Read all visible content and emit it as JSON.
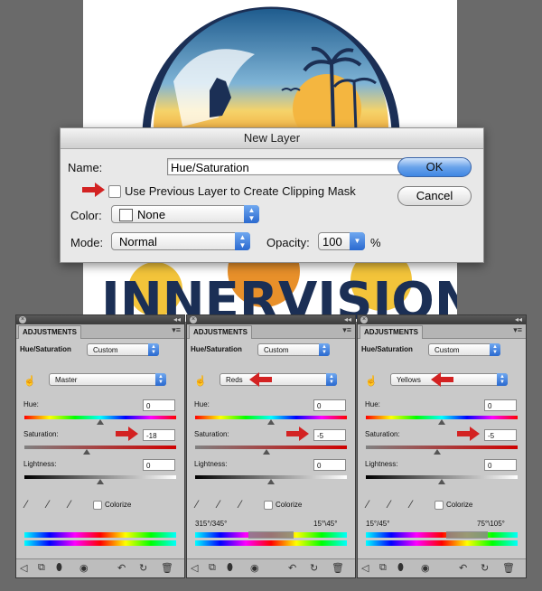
{
  "dialog": {
    "title": "New Layer",
    "name_label": "Name:",
    "name_value": "Hue/Saturation",
    "clip_label": "Use Previous Layer to Create Clipping Mask",
    "color_label": "Color:",
    "color_value": "None",
    "mode_label": "Mode:",
    "mode_value": "Normal",
    "opacity_label": "Opacity:",
    "opacity_value": "100",
    "opacity_unit": "%",
    "ok_label": "OK",
    "cancel_label": "Cancel"
  },
  "artwork": {
    "logo_text": "INNERVISIONS"
  },
  "panels": [
    {
      "tab": "ADJUSTMENTS",
      "type": "Hue/Saturation",
      "preset": "Custom",
      "channel": "Master",
      "hue_label": "Hue:",
      "hue": "0",
      "sat_label": "Saturation:",
      "sat": "-18",
      "light_label": "Lightness:",
      "light": "0",
      "colorize_label": "Colorize",
      "range_left": "",
      "range_right": ""
    },
    {
      "tab": "ADJUSTMENTS",
      "type": "Hue/Saturation",
      "preset": "Custom",
      "channel": "Reds",
      "hue_label": "Hue:",
      "hue": "0",
      "sat_label": "Saturation:",
      "sat": "-5",
      "light_label": "Lightness:",
      "light": "0",
      "colorize_label": "Colorize",
      "range_left": "315°/345°",
      "range_right": "15°\\45°"
    },
    {
      "tab": "ADJUSTMENTS",
      "type": "Hue/Saturation",
      "preset": "Custom",
      "channel": "Yellows",
      "hue_label": "Hue:",
      "hue": "0",
      "sat_label": "Saturation:",
      "sat": "-5",
      "light_label": "Lightness:",
      "light": "0",
      "colorize_label": "Colorize",
      "range_left": "15°/45°",
      "range_right": "75°\\105°"
    }
  ],
  "colors": {
    "accent_blue": "#3f86e3",
    "arrow_red": "#d32222",
    "logo_navy": "#1b2f55",
    "sun_orange": "#f2a431"
  }
}
